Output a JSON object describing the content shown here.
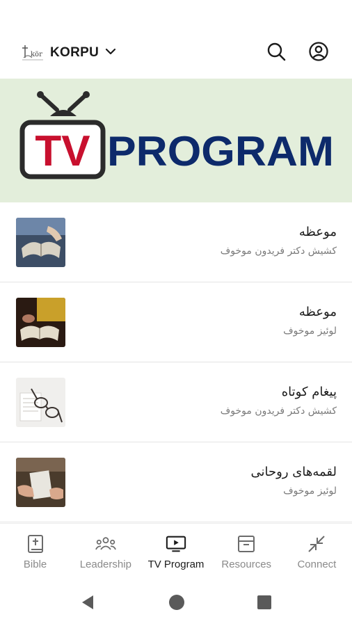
{
  "header": {
    "org_name": "KORPU",
    "logo_icon": "church-logo-icon",
    "search_icon": "search-icon",
    "account_icon": "account-circle-icon"
  },
  "banner": {
    "tv_text": "TV",
    "program_text": "PROGRAM",
    "colors": {
      "background": "#e3eedb",
      "tv_red": "#c8102e",
      "program_navy": "#0d2a6b",
      "tv_frame": "#2b2b2b"
    }
  },
  "items": [
    {
      "title": "موعظه",
      "subtitle": "کشیش دکتر فریدون موخوف"
    },
    {
      "title": "موعظه",
      "subtitle": "لوئیز موخوف"
    },
    {
      "title": "پیغام کوتاه",
      "subtitle": "کشیش دکتر فریدون موخوف"
    },
    {
      "title": "لقمه‌های روحانی",
      "subtitle": "لوئیز موخوف"
    }
  ],
  "nav": {
    "items": [
      {
        "label": "Bible",
        "icon": "bible-icon"
      },
      {
        "label": "Leadership",
        "icon": "people-icon"
      },
      {
        "label": "TV Program",
        "icon": "tv-play-icon"
      },
      {
        "label": "Resources",
        "icon": "archive-box-icon"
      },
      {
        "label": "Connect",
        "icon": "collapse-arrows-icon"
      }
    ],
    "active": "TV Program"
  }
}
